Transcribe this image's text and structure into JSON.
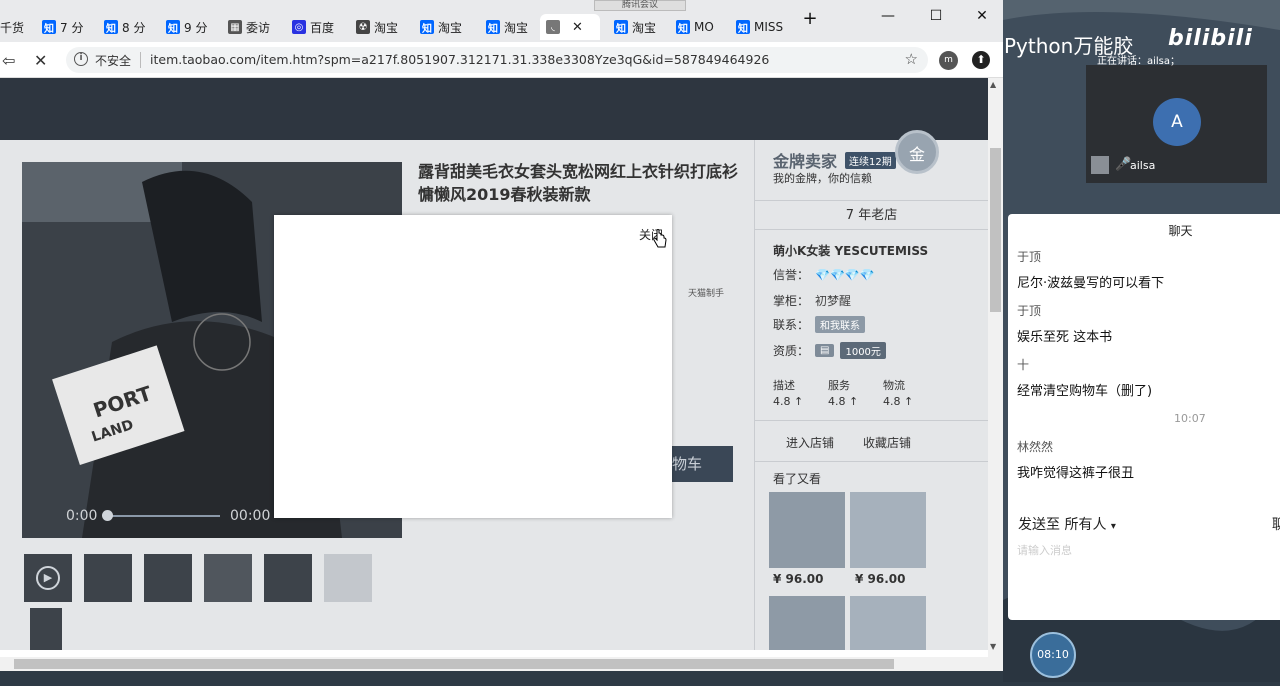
{
  "tabs": [
    {
      "label": "千货",
      "fav": "T",
      "color": "#e85d0c"
    },
    {
      "label": "7 分",
      "fav": "知",
      "color": "#0066ff"
    },
    {
      "label": "8 分",
      "fav": "知",
      "color": "#0066ff"
    },
    {
      "label": "9 分",
      "fav": "知",
      "color": "#0066ff"
    },
    {
      "label": "委访",
      "fav": "▦",
      "color": "#555555"
    },
    {
      "label": "百度",
      "fav": "◎",
      "color": "#2932e1"
    },
    {
      "label": "淘宝",
      "fav": "☢",
      "color": "#444444"
    },
    {
      "label": "淘宝",
      "fav": "知",
      "color": "#0066ff"
    },
    {
      "label": "淘宝",
      "fav": "知",
      "color": "#0066ff"
    },
    {
      "label": "",
      "fav": "◟",
      "color": "#777777"
    },
    {
      "label": "淘宝",
      "fav": "知",
      "color": "#0066ff"
    },
    {
      "label": "MO",
      "fav": "知",
      "color": "#0066ff"
    },
    {
      "label": "MISS",
      "fav": "知",
      "color": "#0066ff"
    }
  ],
  "tooltip": "腾讯会议",
  "window": {
    "new_tab": "+",
    "minimize": "—",
    "maximize": "☐",
    "close": "✕"
  },
  "address": {
    "back": "⇦",
    "reload": "✕",
    "insecure": "不安全",
    "url": "item.taobao.com/item.htm?spm=a217f.8051907.312171.31.338e3308Yze3qG&id=587849464926",
    "avatar": "m"
  },
  "product": {
    "title": "露背甜美毛衣女套头宽松网红上衣针织打底衫慵懒风2019春秋装新款",
    "video_time_left": "0:00",
    "video_time_right": "00:00",
    "partial_note": "天猫制手",
    "cart_partial": "物车"
  },
  "seller": {
    "gold": "金牌卖家",
    "badge": "连续12期",
    "sub": "我的金牌，你的信赖",
    "medal": "金",
    "years": "7 年老店",
    "shop_name": "萌小K女装 YESCUTEMISS",
    "credit_label": "信誉：",
    "credit_val": "💎💎💎💎",
    "keeper_label": "掌柜：",
    "keeper_val": "初梦醒",
    "contact_label": "联系：",
    "contact_val": "和我联系",
    "qual_label": "资质：",
    "qual_val": "1000元",
    "ratings": [
      {
        "label": "描述",
        "score": "4.8 ↑"
      },
      {
        "label": "服务",
        "score": "4.8 ↑"
      },
      {
        "label": "物流",
        "score": "4.8 ↑"
      }
    ],
    "enter_shop": "进入店铺",
    "fav_shop": "收藏店铺",
    "seen": "看了又看",
    "price1": "¥ 96.00",
    "price2": "¥ 96.00"
  },
  "modal": {
    "close": "关闭"
  },
  "meeting": {
    "brand": "Python万能胶",
    "bili": "bilibili",
    "speaking": "正在讲话：ailsa；",
    "avatar": "A",
    "user": "ailsa"
  },
  "chat": {
    "title": "聊天",
    "messages": [
      {
        "who": "于顶",
        "text": "尼尔·波兹曼写的可以看下"
      },
      {
        "who": "于顶",
        "text": "娱乐至死 这本书"
      },
      {
        "who": "十",
        "text": "经常清空购物车（删了)"
      },
      {
        "who": "林然然",
        "text": "我咋觉得这裤子很丑"
      }
    ],
    "time": "10:07",
    "send_to": "发送至",
    "audience": "所有人",
    "input_placeholder": "请输入消息",
    "right_partial": "聊"
  },
  "timer": "08:10"
}
